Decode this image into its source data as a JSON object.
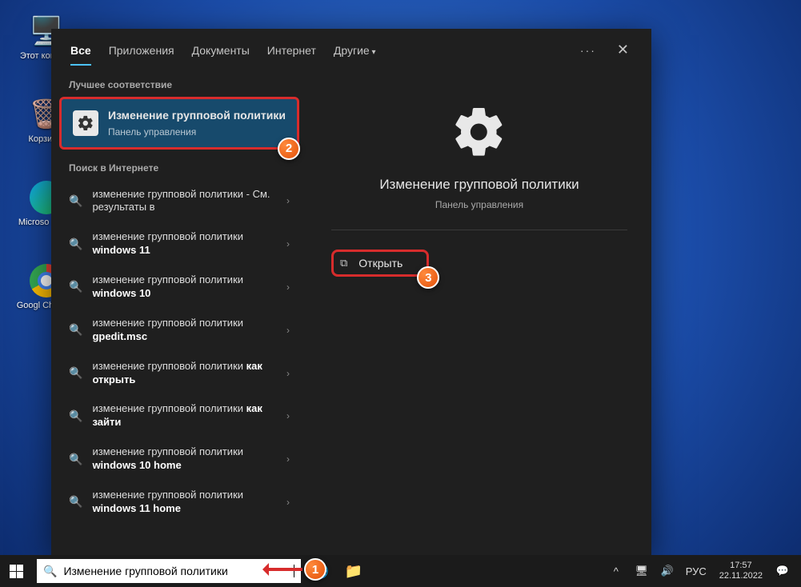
{
  "desktop": {
    "pc_label": "Этот компь...",
    "bin_label": "Корзин...",
    "edge_label": "Microso Edg...",
    "chrome_label": "Googl Chrom..."
  },
  "tabs": {
    "all": "Все",
    "apps": "Приложения",
    "docs": "Документы",
    "web": "Интернет",
    "more": "Другие"
  },
  "sections": {
    "best_match": "Лучшее соответствие",
    "web_search": "Поиск в Интернете"
  },
  "best": {
    "title": "Изменение групповой политики",
    "subtitle": "Панель управления"
  },
  "web_items": [
    {
      "pre": "изменение групповой политики",
      "suf": " - См. результаты в"
    },
    {
      "pre": "изменение групповой политики ",
      "suf": "windows 11"
    },
    {
      "pre": "изменение групповой политики ",
      "suf": "windows 10"
    },
    {
      "pre": "изменение групповой политики ",
      "suf": "gpedit.msc"
    },
    {
      "pre": "изменение групповой политики ",
      "suf": "как открыть"
    },
    {
      "pre": "изменение групповой политики ",
      "suf": "как зайти"
    },
    {
      "pre": "изменение групповой политики ",
      "suf": "windows 10 home"
    },
    {
      "pre": "изменение групповой политики ",
      "suf": "windows 11 home"
    }
  ],
  "right": {
    "title": "Изменение групповой политики",
    "subtitle": "Панель управления",
    "open": "Открыть"
  },
  "taskbar": {
    "search_value": "Изменение групповой политики",
    "lang": "РУС",
    "time": "17:57",
    "date": "22.11.2022"
  },
  "annotations": {
    "n1": "1",
    "n2": "2",
    "n3": "3"
  }
}
